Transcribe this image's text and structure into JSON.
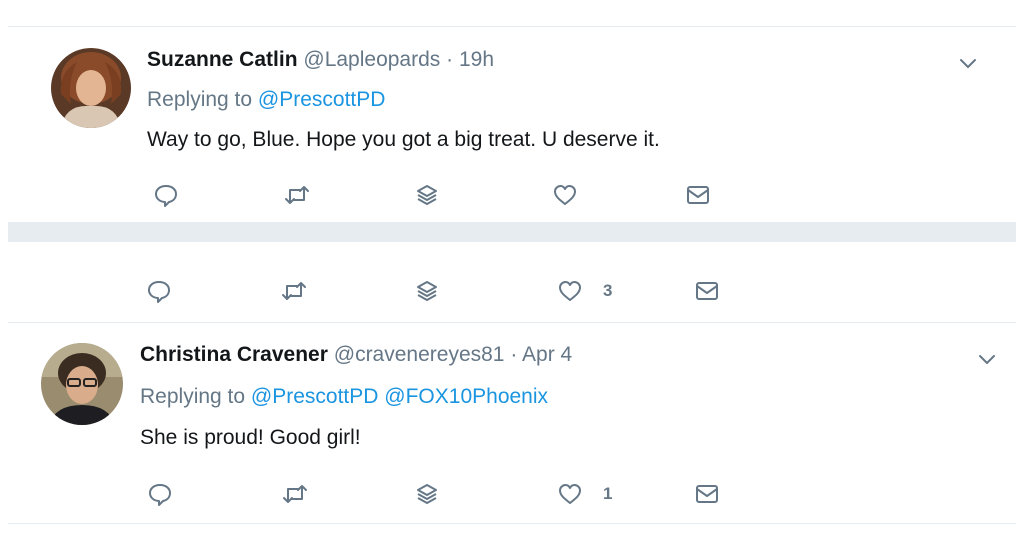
{
  "tweets": [
    {
      "author_name": "Suzanne Catlin",
      "handle": "@Lapleopards",
      "time": "19h",
      "replying_label": "Replying to",
      "replying_to": [
        "@PrescottPD"
      ],
      "text": "Way to go, Blue.  Hope you got a big treat.  U deserve it.",
      "like_count": ""
    },
    {
      "author_name": "",
      "handle": "",
      "time": "",
      "replying_label": "",
      "replying_to": [],
      "text": "",
      "like_count": "3"
    },
    {
      "author_name": "Christina Cravener",
      "handle": "@cravenereyes81",
      "time": "Apr 4",
      "replying_label": "Replying to",
      "replying_to": [
        "@PrescottPD",
        "@FOX10Phoenix"
      ],
      "text": "She is proud! Good girl!",
      "like_count": "1"
    }
  ],
  "separator": "·",
  "icons": {
    "reply": "reply-icon",
    "retweet": "retweet-icon",
    "stack": "stack-icon",
    "like": "heart-icon",
    "dm": "direct-message-icon",
    "more": "chevron-down-icon"
  },
  "colors": {
    "link": "#1b95e0",
    "muted": "#657786",
    "divider": "#e6ecf0",
    "text": "#14171a"
  }
}
